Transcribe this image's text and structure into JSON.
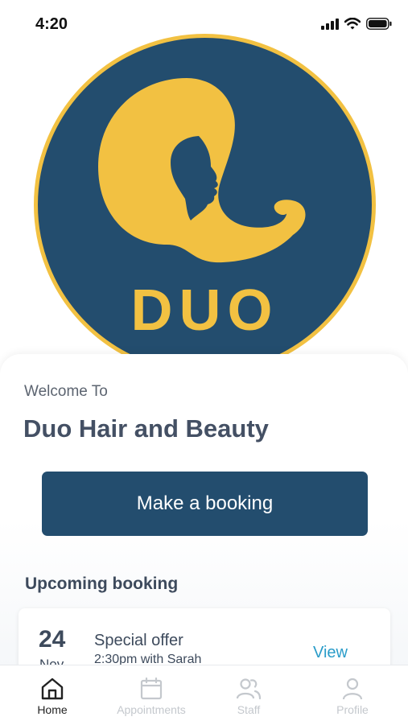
{
  "status_bar": {
    "time": "4:20"
  },
  "logo": {
    "text": "DUO",
    "colors": {
      "circle": "#234d6e",
      "gold": "#f2c142"
    }
  },
  "welcome": {
    "greeting": "Welcome To",
    "business_name": "Duo Hair and Beauty"
  },
  "primary_action": {
    "label": "Make a booking",
    "color": "#234d6e"
  },
  "upcoming": {
    "heading": "Upcoming booking",
    "booking": {
      "day": "24",
      "month": "Nov",
      "title": "Special offer",
      "subtitle": "2:30pm with Sarah",
      "action": "View"
    }
  },
  "tab_bar": {
    "tabs": [
      {
        "label": "Home",
        "icon": "home-icon",
        "active": true
      },
      {
        "label": "Appointments",
        "icon": "calendar-icon",
        "active": false
      },
      {
        "label": "Staff",
        "icon": "users-icon",
        "active": false
      },
      {
        "label": "Profile",
        "icon": "person-icon",
        "active": false
      }
    ]
  }
}
